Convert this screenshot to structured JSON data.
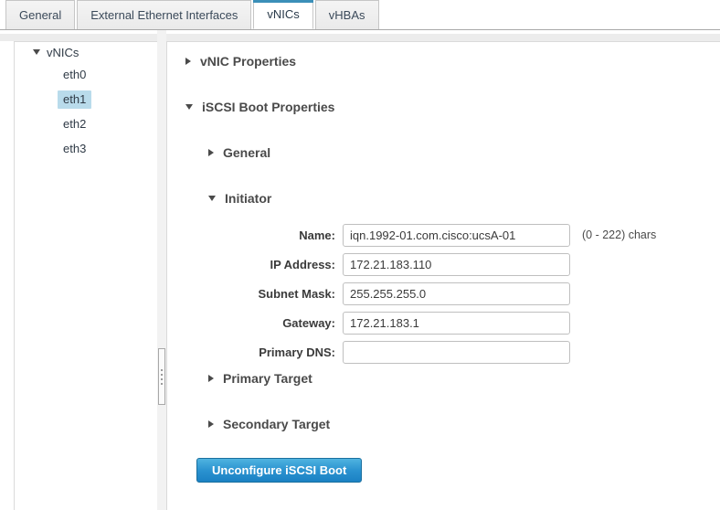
{
  "tabs": [
    {
      "label": "General",
      "active": false
    },
    {
      "label": "External Ethernet Interfaces",
      "active": false
    },
    {
      "label": "vNICs",
      "active": true
    },
    {
      "label": "vHBAs",
      "active": false
    }
  ],
  "tree": {
    "root_label": "vNICs",
    "items": [
      {
        "label": "eth0",
        "selected": false
      },
      {
        "label": "eth1",
        "selected": true
      },
      {
        "label": "eth2",
        "selected": false
      },
      {
        "label": "eth3",
        "selected": false
      }
    ]
  },
  "sections": {
    "vnic_properties": {
      "label": "vNIC Properties",
      "expanded": false
    },
    "iscsi_boot_properties": {
      "label": "iSCSI Boot Properties",
      "expanded": true
    },
    "general": {
      "label": "General",
      "expanded": false
    },
    "initiator": {
      "label": "Initiator",
      "expanded": true
    },
    "primary_target": {
      "label": "Primary Target",
      "expanded": false
    },
    "secondary_target": {
      "label": "Secondary Target",
      "expanded": false
    }
  },
  "initiator_form": {
    "fields": [
      {
        "label": "Name:",
        "value": "iqn.1992-01.com.cisco:ucsA-01",
        "hint": "(0 - 222) chars"
      },
      {
        "label": "IP Address:",
        "value": "172.21.183.110",
        "hint": ""
      },
      {
        "label": "Subnet Mask:",
        "value": "255.255.255.0",
        "hint": ""
      },
      {
        "label": "Gateway:",
        "value": "172.21.183.1",
        "hint": ""
      },
      {
        "label": "Primary DNS:",
        "value": "",
        "hint": ""
      }
    ]
  },
  "actions": {
    "unconfigure_label": "Unconfigure iSCSI Boot"
  },
  "colors": {
    "tab_accent": "#3b8fb8",
    "selection": "#b9dbeb",
    "button_blue": "#2b93d0",
    "text_dark": "#3a3a3a"
  }
}
